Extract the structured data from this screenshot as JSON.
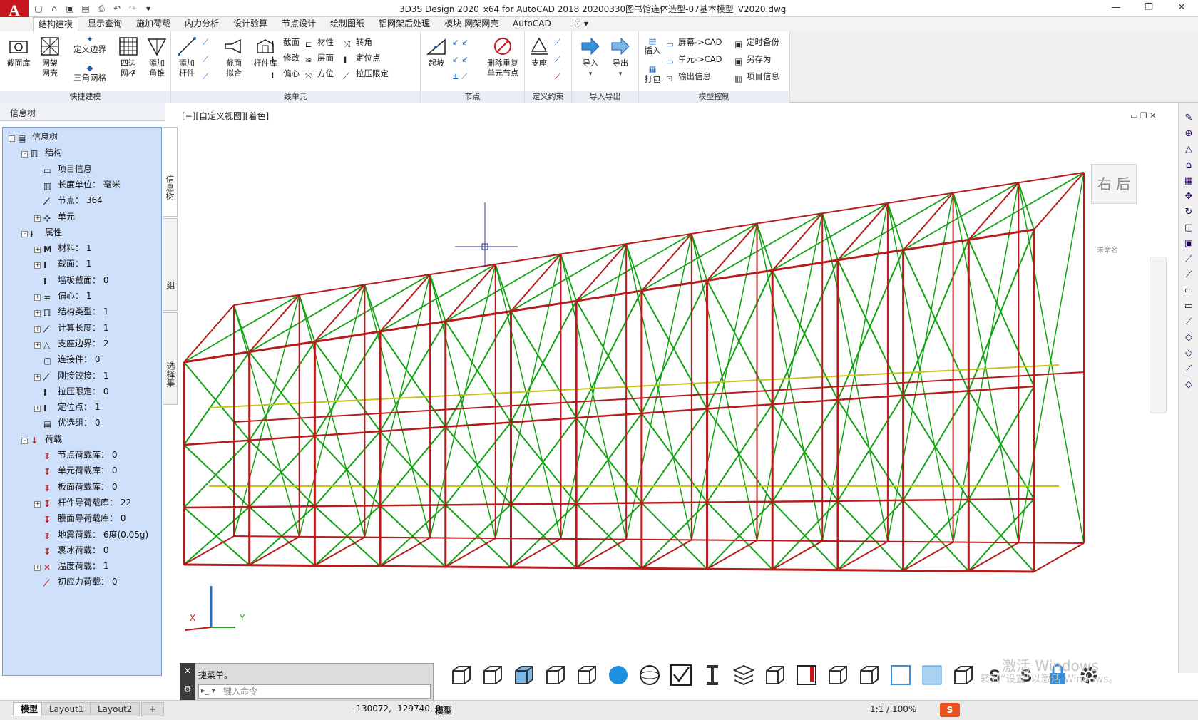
{
  "title": {
    "app_logo": "A",
    "text": "3D3S Design 2020_x64 for AutoCAD 2018     20200330图书馆连体造型-07基本模型_V2020.dwg"
  },
  "tabs": [
    "结构建模",
    "显示查询",
    "施加荷载",
    "内力分析",
    "设计验算",
    "节点设计",
    "绘制图纸",
    "铝网架后处理",
    "模块-网架网壳",
    "AutoCAD"
  ],
  "ribbon": {
    "p1": {
      "title": "快捷建模",
      "b1": "截面库",
      "b2a": "网架",
      "b2b": "网壳",
      "b3": "定义边界",
      "b4": "三角网格",
      "b5a": "四边",
      "b5b": "网格",
      "b6a": "添加",
      "b6b": "角锥"
    },
    "p2": {
      "title": "线单元",
      "b1a": "添加",
      "b1b": "杆件",
      "b2a": "截面",
      "b2b": "拟合",
      "b3": "杆件库",
      "s1": "截面",
      "s2": "修改",
      "s3": "偏心",
      "s4": "材性",
      "s5": "层面",
      "s6": "方位",
      "s7": "转角",
      "s8": "定位点",
      "s9": "拉压限定"
    },
    "p3": {
      "title": "节点",
      "b1": "起坡",
      "b2a": "删除重复",
      "b2b": "单元节点"
    },
    "p4": {
      "title": "定义约束",
      "b1": "支座"
    },
    "p5": {
      "title": "导入导出",
      "b1": "导入",
      "b2": "导出"
    },
    "p6": {
      "title": "模型控制",
      "b1": "插入",
      "b2": "打包",
      "s1": "屏幕->CAD",
      "s2": "单元->CAD",
      "s3": "输出信息",
      "s4": "定时备份",
      "s5": "另存为",
      "s6": "项目信息"
    }
  },
  "left_panel": {
    "header": "信息树",
    "side_tabs": [
      "信息树",
      "组",
      "选择集"
    ],
    "tree": [
      {
        "label": "信息树",
        "indent": 0,
        "exp": "-"
      },
      {
        "label": "结构",
        "indent": 1,
        "exp": "-"
      },
      {
        "label": "项目信息",
        "indent": 2,
        "exp": ""
      },
      {
        "label": "长度单位：  毫米",
        "indent": 2,
        "exp": ""
      },
      {
        "label": "节点：   364",
        "indent": 2,
        "exp": ""
      },
      {
        "label": "单元",
        "indent": 2,
        "exp": "+"
      },
      {
        "label": "属性",
        "indent": 1,
        "exp": "-"
      },
      {
        "label": "材料：  1",
        "indent": 2,
        "exp": "+"
      },
      {
        "label": "截面：   1",
        "indent": 2,
        "exp": "+"
      },
      {
        "label": "墙板截面：  0",
        "indent": 2,
        "exp": ""
      },
      {
        "label": "偏心：  1",
        "indent": 2,
        "exp": "+"
      },
      {
        "label": "结构类型：  1",
        "indent": 2,
        "exp": "+"
      },
      {
        "label": "计算长度：  1",
        "indent": 2,
        "exp": "+"
      },
      {
        "label": "支座边界：  2",
        "indent": 2,
        "exp": "+"
      },
      {
        "label": "连接件：  0",
        "indent": 2,
        "exp": ""
      },
      {
        "label": "刚接铰接：  1",
        "indent": 2,
        "exp": "+"
      },
      {
        "label": "拉压限定：  0",
        "indent": 2,
        "exp": ""
      },
      {
        "label": "定位点：  1",
        "indent": 2,
        "exp": "+"
      },
      {
        "label": "优选组：  0",
        "indent": 2,
        "exp": ""
      },
      {
        "label": "荷载",
        "indent": 1,
        "exp": "-"
      },
      {
        "label": "节点荷载库：  0",
        "indent": 2,
        "exp": ""
      },
      {
        "label": "单元荷载库：  0",
        "indent": 2,
        "exp": ""
      },
      {
        "label": "板面荷载库：  0",
        "indent": 2,
        "exp": ""
      },
      {
        "label": "杆件导荷载库：  22",
        "indent": 2,
        "exp": "+"
      },
      {
        "label": "膜面导荷载库：  0",
        "indent": 2,
        "exp": ""
      },
      {
        "label": "地震荷载：  6度(0.05g)",
        "indent": 2,
        "exp": ""
      },
      {
        "label": "裹冰荷载：  0",
        "indent": 2,
        "exp": ""
      },
      {
        "label": "温度荷载：  1",
        "indent": 2,
        "exp": "+"
      },
      {
        "label": "初应力荷载：  0",
        "indent": 2,
        "exp": ""
      }
    ]
  },
  "viewport": {
    "label": "[−][自定义视图][着色]",
    "viewcube_face": "右 后",
    "viewcube_label": "未命名",
    "axis_x": "X",
    "axis_y": "Y",
    "colors": {
      "chord": "#b71c1c",
      "web": "#12a312",
      "tie": "#c9c21a"
    }
  },
  "command": {
    "history": "捷菜单。",
    "placeholder": "键入命令"
  },
  "status": {
    "layouts": [
      "模型",
      "Layout1",
      "Layout2"
    ],
    "add_layout": "+",
    "coords": "-130072, -129740, 0",
    "mode": "模型",
    "scale": "1:1 / 100%"
  },
  "watermark": {
    "line1": "激活 Windows",
    "line2": "转到“设置”以激活 Windows。"
  }
}
